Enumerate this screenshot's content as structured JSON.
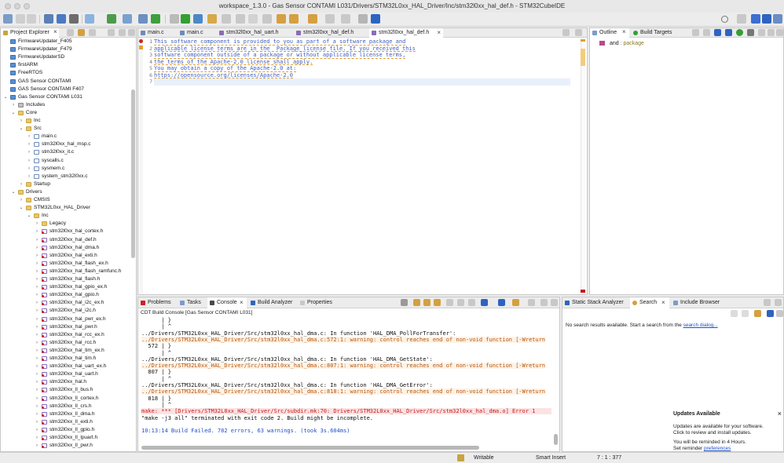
{
  "window": {
    "title": "workspace_1.3.0 - Gas Sensor CONTAMI L031/Drivers/STM32L0xx_HAL_Driver/Inc/stm32l0xx_hal_def.h - STM32CubeIDE"
  },
  "project_explorer": {
    "tab_label": "Project Explorer",
    "items": [
      {
        "label": "FirmwareUpdater_F405",
        "depth": 0,
        "icon": "proj",
        "tw": ""
      },
      {
        "label": "FirmwareUpdater_F479",
        "depth": 0,
        "icon": "proj",
        "tw": ""
      },
      {
        "label": "FirmwareUpdaterSD",
        "depth": 0,
        "icon": "proj",
        "tw": ""
      },
      {
        "label": "firstARM",
        "depth": 0,
        "icon": "proj",
        "tw": ""
      },
      {
        "label": "FreeRTOS",
        "depth": 0,
        "icon": "proj",
        "tw": ""
      },
      {
        "label": "GAS Sensor CONTAMI",
        "depth": 0,
        "icon": "proj",
        "tw": ""
      },
      {
        "label": "GAS Sensor CONTAMI F407",
        "depth": 0,
        "icon": "proj",
        "tw": ""
      },
      {
        "label": "Gas Sensor CONTAMI L031",
        "depth": 0,
        "icon": "proj",
        "tw": "open"
      },
      {
        "label": "Includes",
        "depth": 1,
        "icon": "inc",
        "tw": "closed"
      },
      {
        "label": "Core",
        "depth": 1,
        "icon": "folder",
        "tw": "open"
      },
      {
        "label": "Inc",
        "depth": 2,
        "icon": "folder",
        "tw": "closed"
      },
      {
        "label": "Src",
        "depth": 2,
        "icon": "folder",
        "tw": "open"
      },
      {
        "label": "main.c",
        "depth": 3,
        "icon": "cfile",
        "tw": "closed"
      },
      {
        "label": "stm32l0xx_hal_msp.c",
        "depth": 3,
        "icon": "cfile",
        "tw": "closed"
      },
      {
        "label": "stm32l0xx_it.c",
        "depth": 3,
        "icon": "cfile",
        "tw": "closed"
      },
      {
        "label": "syscalls.c",
        "depth": 3,
        "icon": "cfile",
        "tw": "closed"
      },
      {
        "label": "sysmem.c",
        "depth": 3,
        "icon": "cfile",
        "tw": "closed"
      },
      {
        "label": "system_stm32l0xx.c",
        "depth": 3,
        "icon": "cfile",
        "tw": "closed"
      },
      {
        "label": "Startup",
        "depth": 2,
        "icon": "folder",
        "tw": "closed"
      },
      {
        "label": "Drivers",
        "depth": 1,
        "icon": "folder",
        "tw": "open"
      },
      {
        "label": "CMSIS",
        "depth": 2,
        "icon": "folder",
        "tw": "closed"
      },
      {
        "label": "STM32L0xx_HAL_Driver",
        "depth": 2,
        "icon": "folder",
        "tw": "open"
      },
      {
        "label": "Inc",
        "depth": 3,
        "icon": "folder",
        "tw": "open"
      },
      {
        "label": "Legacy",
        "depth": 4,
        "icon": "folder",
        "tw": "closed"
      },
      {
        "label": "stm32l0xx_hal_cortex.h",
        "depth": 4,
        "icon": "err",
        "tw": "closed"
      },
      {
        "label": "stm32l0xx_hal_def.h",
        "depth": 4,
        "icon": "err",
        "tw": "closed"
      },
      {
        "label": "stm32l0xx_hal_dma.h",
        "depth": 4,
        "icon": "err",
        "tw": "closed"
      },
      {
        "label": "stm32l0xx_hal_exti.h",
        "depth": 4,
        "icon": "err",
        "tw": "closed"
      },
      {
        "label": "stm32l0xx_hal_flash_ex.h",
        "depth": 4,
        "icon": "err",
        "tw": "closed"
      },
      {
        "label": "stm32l0xx_hal_flash_ramfunc.h",
        "depth": 4,
        "icon": "err",
        "tw": "closed"
      },
      {
        "label": "stm32l0xx_hal_flash.h",
        "depth": 4,
        "icon": "err",
        "tw": "closed"
      },
      {
        "label": "stm32l0xx_hal_gpio_ex.h",
        "depth": 4,
        "icon": "err",
        "tw": "closed"
      },
      {
        "label": "stm32l0xx_hal_gpio.h",
        "depth": 4,
        "icon": "err",
        "tw": "closed"
      },
      {
        "label": "stm32l0xx_hal_i2c_ex.h",
        "depth": 4,
        "icon": "err",
        "tw": "closed"
      },
      {
        "label": "stm32l0xx_hal_i2c.h",
        "depth": 4,
        "icon": "err",
        "tw": "closed"
      },
      {
        "label": "stm32l0xx_hal_pwr_ex.h",
        "depth": 4,
        "icon": "err",
        "tw": "closed"
      },
      {
        "label": "stm32l0xx_hal_pwr.h",
        "depth": 4,
        "icon": "err",
        "tw": "closed"
      },
      {
        "label": "stm32l0xx_hal_rcc_ex.h",
        "depth": 4,
        "icon": "err",
        "tw": "closed"
      },
      {
        "label": "stm32l0xx_hal_rcc.h",
        "depth": 4,
        "icon": "err",
        "tw": "closed"
      },
      {
        "label": "stm32l0xx_hal_tim_ex.h",
        "depth": 4,
        "icon": "err",
        "tw": "closed"
      },
      {
        "label": "stm32l0xx_hal_tim.h",
        "depth": 4,
        "icon": "err",
        "tw": "closed"
      },
      {
        "label": "stm32l0xx_hal_uart_ex.h",
        "depth": 4,
        "icon": "err",
        "tw": "closed"
      },
      {
        "label": "stm32l0xx_hal_uart.h",
        "depth": 4,
        "icon": "err",
        "tw": "closed"
      },
      {
        "label": "stm32l0xx_hal.h",
        "depth": 4,
        "icon": "err",
        "tw": "closed"
      },
      {
        "label": "stm32l0xx_ll_bus.h",
        "depth": 4,
        "icon": "err",
        "tw": "closed"
      },
      {
        "label": "stm32l0xx_ll_cortex.h",
        "depth": 4,
        "icon": "err",
        "tw": "closed"
      },
      {
        "label": "stm32l0xx_ll_crs.h",
        "depth": 4,
        "icon": "err",
        "tw": "closed"
      },
      {
        "label": "stm32l0xx_ll_dma.h",
        "depth": 4,
        "icon": "err",
        "tw": "closed"
      },
      {
        "label": "stm32l0xx_ll_exti.h",
        "depth": 4,
        "icon": "err",
        "tw": "closed"
      },
      {
        "label": "stm32l0xx_ll_gpio.h",
        "depth": 4,
        "icon": "err",
        "tw": "closed"
      },
      {
        "label": "stm32l0xx_ll_lpuart.h",
        "depth": 4,
        "icon": "err",
        "tw": "closed"
      },
      {
        "label": "stm32l0xx_ll_pwr.h",
        "depth": 4,
        "icon": "err",
        "tw": "closed"
      }
    ]
  },
  "editor": {
    "tabs": [
      {
        "label": "main.c",
        "active": false
      },
      {
        "label": "main.c",
        "active": false
      },
      {
        "label": "stm32l0xx_hal_uart.h",
        "active": false
      },
      {
        "label": "stm32l0xx_hal_def.h",
        "active": false
      },
      {
        "label": "stm32l0xx_hal_def.h",
        "active": true
      }
    ],
    "lines": [
      {
        "num": "1",
        "text": "This software component is provided to you as part of a software package and"
      },
      {
        "num": "2",
        "text": "applicable license terms are in the  Package_license file. If you received this"
      },
      {
        "num": "3",
        "text": "software component outside of a package or without applicable license terms,"
      },
      {
        "num": "4",
        "text": "the terms of the Apache-2.0 license shall apply."
      },
      {
        "num": "5",
        "text": "You may obtain a copy of the Apache-2.0 at:"
      },
      {
        "num": "6",
        "text": "https://opensource.org/licenses/Apache-2.0"
      },
      {
        "num": "7",
        "text": ""
      }
    ]
  },
  "outline": {
    "tabs": [
      {
        "label": "Outline"
      },
      {
        "label": "Build Targets"
      }
    ],
    "item_name": "and",
    "item_type": ": package"
  },
  "console": {
    "tabs": [
      {
        "label": "Problems"
      },
      {
        "label": "Tasks"
      },
      {
        "label": "Console"
      },
      {
        "label": "Build Analyzer"
      },
      {
        "label": "Properties"
      }
    ],
    "header": "CDT Build Console [Gas Sensor CONTAMI L031]",
    "lines": [
      {
        "text": "      | }",
        "kind": "normal"
      },
      {
        "text": "      | ^",
        "kind": "normal"
      },
      {
        "text": "../Drivers/STM32L0xx_HAL_Driver/Src/stm32l0xx_hal_dma.c: In function 'HAL_DMA_PollForTransfer':",
        "kind": "normal"
      },
      {
        "text": "../Drivers/STM32L0xx_HAL_Driver/Src/stm32l0xx_hal_dma.c:572:1: warning: control reaches end of non-void function [-Wreturn",
        "kind": "warn"
      },
      {
        "text": "  572 | }",
        "kind": "normal"
      },
      {
        "text": "      | ^",
        "kind": "normal"
      },
      {
        "text": "../Drivers/STM32L0xx_HAL_Driver/Src/stm32l0xx_hal_dma.c: In function 'HAL_DMA_GetState':",
        "kind": "normal"
      },
      {
        "text": "../Drivers/STM32L0xx_HAL_Driver/Src/stm32l0xx_hal_dma.c:807:1: warning: control reaches end of non-void function [-Wreturn",
        "kind": "warn"
      },
      {
        "text": "  807 | }",
        "kind": "normal"
      },
      {
        "text": "      | ^",
        "kind": "normal"
      },
      {
        "text": "../Drivers/STM32L0xx_HAL_Driver/Src/stm32l0xx_hal_dma.c: In function 'HAL_DMA_GetError':",
        "kind": "normal"
      },
      {
        "text": "../Drivers/STM32L0xx_HAL_Driver/Src/stm32l0xx_hal_dma.c:818:1: warning: control reaches end of non-void function [-Wreturn",
        "kind": "warn"
      },
      {
        "text": "  818 | }",
        "kind": "normal"
      },
      {
        "text": "      | ^",
        "kind": "normal"
      },
      {
        "text": "make: *** [Drivers/STM32L0xx_HAL_Driver/Src/subdir.mk:70: Drivers/STM32L0xx_HAL_Driver/Src/stm32l0xx_hal_dma.o] Error 1",
        "kind": "err"
      },
      {
        "text": "\"make -j3 all\" terminated with exit code 2. Build might be incomplete.",
        "kind": "normal"
      },
      {
        "text": "",
        "kind": "normal"
      },
      {
        "text": "10:13:14 Build Failed. 782 errors, 63 warnings. (took 3s.604ms)",
        "kind": "info"
      }
    ]
  },
  "right_bottom": {
    "tabs": [
      {
        "label": "Static Stack Analyzer"
      },
      {
        "label": "Search"
      },
      {
        "label": "Include Browser"
      }
    ],
    "message_prefix": "No search results available. Start a search from the ",
    "message_link": "search dialog..."
  },
  "notification": {
    "title": "Updates Available",
    "body_line1": "Updates are available for your software.",
    "body_line2": "Click to review and install updates.",
    "remind_line1": "You will be reminded in 4 Hours.",
    "remind_prefix": "Set reminder ",
    "remind_link": "preferences"
  },
  "statusbar": {
    "mode": "Writable",
    "insert": "Smart Insert",
    "position": "7 : 1 : 377"
  },
  "colors": {
    "accent": "#3b6fd1",
    "warning": "#b8530a",
    "error": "#c81818"
  }
}
